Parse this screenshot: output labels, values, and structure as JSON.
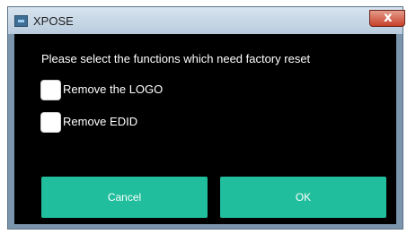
{
  "window": {
    "title": "XPOSE",
    "icon": "xpose-app-icon"
  },
  "dialog": {
    "prompt": "Please select the functions which need factory reset",
    "options": [
      {
        "label": "Remove the LOGO",
        "checked": false
      },
      {
        "label": "Remove EDID",
        "checked": false
      }
    ],
    "buttons": {
      "cancel": "Cancel",
      "ok": "OK"
    }
  },
  "colors": {
    "accent": "#20be9c",
    "background": "#000000",
    "frame": "#7b95ad"
  }
}
